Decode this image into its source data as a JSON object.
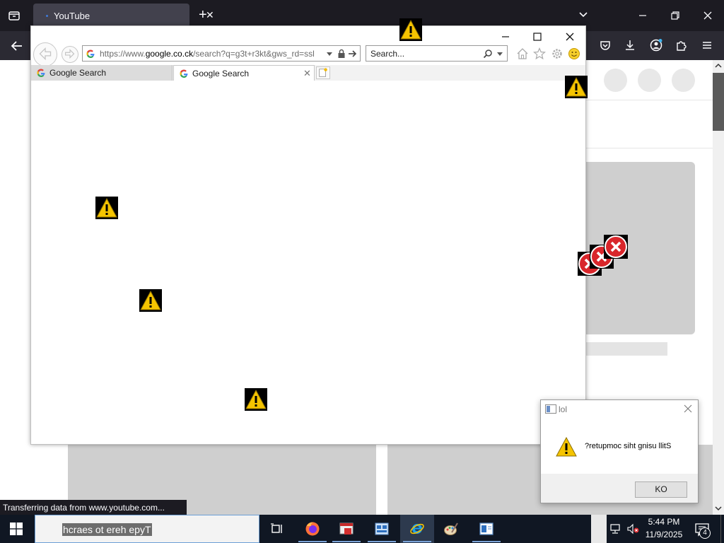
{
  "firefox": {
    "tab_title": "YouTube",
    "status_text": "Transferring data from www.youtube.com..."
  },
  "ie": {
    "url_prefix": "https://www.",
    "url_host": "google.co.ck",
    "url_rest": "/search?q=g3t+r3kt&gws_rd=ssl",
    "search_placeholder": "Search...",
    "tabs": [
      {
        "label": "Google Search"
      },
      {
        "label": "Google Search"
      }
    ]
  },
  "msgbox": {
    "title": "lol",
    "message": "?retupmoc siht gnisu llitS",
    "ok_label": "KO"
  },
  "taskbar": {
    "search_text": "hcraes ot ereh epyT",
    "time": "5:44 PM",
    "date": "11/9/2025",
    "notification_count": "4"
  },
  "colors": {
    "firefox_dark": "#1c1b22",
    "taskbar": "#101723",
    "warning_yellow": "#f5c400",
    "error_red": "#d9262b"
  }
}
